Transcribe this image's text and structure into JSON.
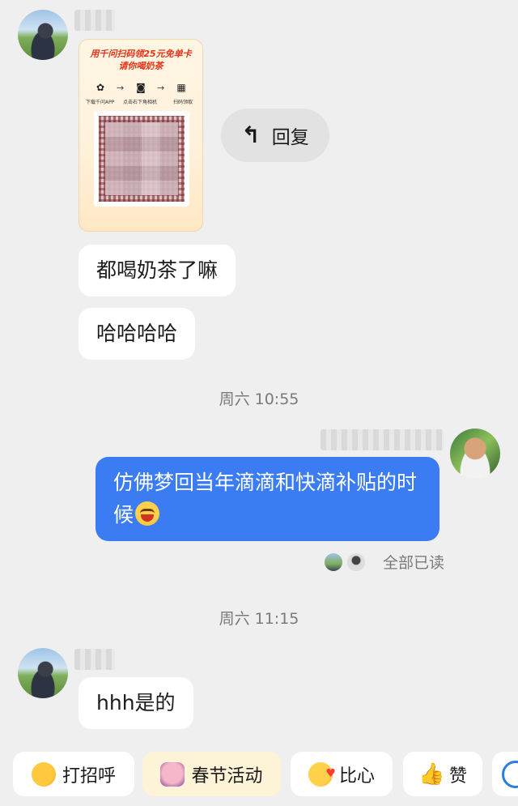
{
  "chat": {
    "reply_label": "回复",
    "qr_card": {
      "title_line1": "用千问扫码领25元免单卡",
      "title_line2": "请你喝奶茶",
      "step1": "下载千问APP",
      "step2": "点击右下角相机",
      "step3": "扫码领取"
    },
    "messages": [
      {
        "text": "都喝奶茶了嘛"
      },
      {
        "text": "哈哈哈哈"
      },
      {
        "text": "仿佛梦回当年滴滴和快滴补贴的时候"
      },
      {
        "text": "hhh是的"
      }
    ],
    "timestamps": [
      "周六 10:55",
      "周六 11:15"
    ],
    "read_status": "全部已读"
  },
  "quick_replies": [
    {
      "label": "打招呼",
      "icon": "wave-emoji-icon"
    },
    {
      "label": "春节活动",
      "icon": "festival-icon"
    },
    {
      "label": "比心",
      "icon": "heart-emoji-icon"
    },
    {
      "label": "赞",
      "icon": "thumbs-up-icon"
    }
  ],
  "colors": {
    "background": "#efefef",
    "outgoing_bubble": "#3b7cf3",
    "incoming_bubble": "#ffffff"
  }
}
